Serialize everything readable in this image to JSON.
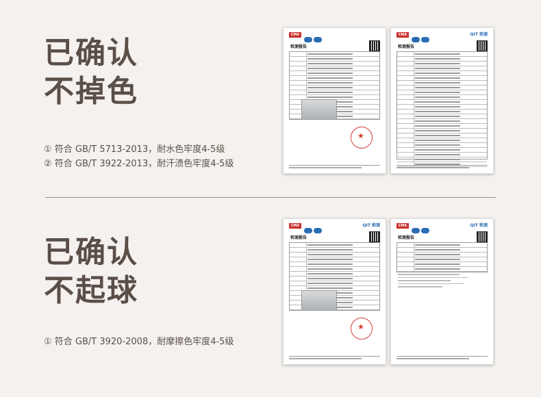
{
  "section1": {
    "headline_line1": "已确认",
    "headline_line2": "不掉色",
    "notes": [
      "① 符合 GB/T 5713-2013，耐水色牢度4-5级",
      "② 符合 GB/T 3922-2013，耐汗渍色牢度4-5级"
    ]
  },
  "section2": {
    "headline_line1": "已确认",
    "headline_line2": "不起球",
    "notes": [
      "① 符合 GB/T 3920-2008，耐摩擦色牢度4-5级"
    ]
  },
  "documents": {
    "cma_label": "CMA",
    "qit_label": "QIT 检测",
    "report_title": "检测报告"
  },
  "colors": {
    "background": "#f4f1ee",
    "headline": "#5a4f48",
    "stamp": "#d23b33",
    "logo_blue": "#2a6db3"
  }
}
